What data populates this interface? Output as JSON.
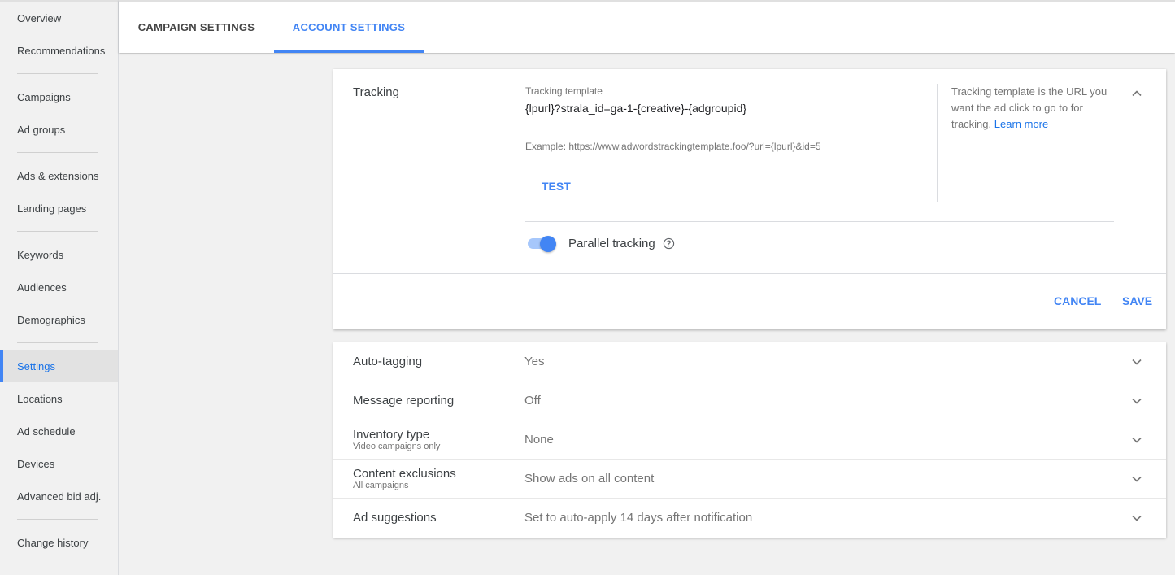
{
  "sidebar": {
    "items": [
      {
        "label": "Overview"
      },
      {
        "label": "Recommendations"
      },
      {
        "label": "Campaigns"
      },
      {
        "label": "Ad groups"
      },
      {
        "label": "Ads & extensions"
      },
      {
        "label": "Landing pages"
      },
      {
        "label": "Keywords"
      },
      {
        "label": "Audiences"
      },
      {
        "label": "Demographics"
      },
      {
        "label": "Settings"
      },
      {
        "label": "Locations"
      },
      {
        "label": "Ad schedule"
      },
      {
        "label": "Devices"
      },
      {
        "label": "Advanced bid adj."
      },
      {
        "label": "Change history"
      }
    ]
  },
  "tabs": {
    "campaign": "CAMPAIGN SETTINGS",
    "account": "ACCOUNT SETTINGS"
  },
  "tracking": {
    "title": "Tracking",
    "template_label": "Tracking template",
    "template_value": "{lpurl}?strala_id=ga-1-{creative}-{adgroupid}",
    "example": "Example: https://www.adwordstrackingtemplate.foo/?url={lpurl}&id=5",
    "test_label": "TEST",
    "help_text": "Tracking template is the URL you want the ad click to go to for tracking.",
    "help_link": "Learn more",
    "parallel_label": "Parallel tracking",
    "parallel_enabled": true,
    "cancel_label": "CANCEL",
    "save_label": "SAVE"
  },
  "settings_rows": [
    {
      "name": "Auto-tagging",
      "sub": "",
      "value": "Yes"
    },
    {
      "name": "Message reporting",
      "sub": "",
      "value": "Off"
    },
    {
      "name": "Inventory type",
      "sub": "Video campaigns only",
      "value": "None"
    },
    {
      "name": "Content exclusions",
      "sub": "All campaigns",
      "value": "Show ads on all content"
    },
    {
      "name": "Ad suggestions",
      "sub": "",
      "value": "Set to auto-apply 14 days after notification"
    }
  ],
  "colors": {
    "accent": "#4285f4",
    "toggle_track": "#a6c7fb"
  }
}
